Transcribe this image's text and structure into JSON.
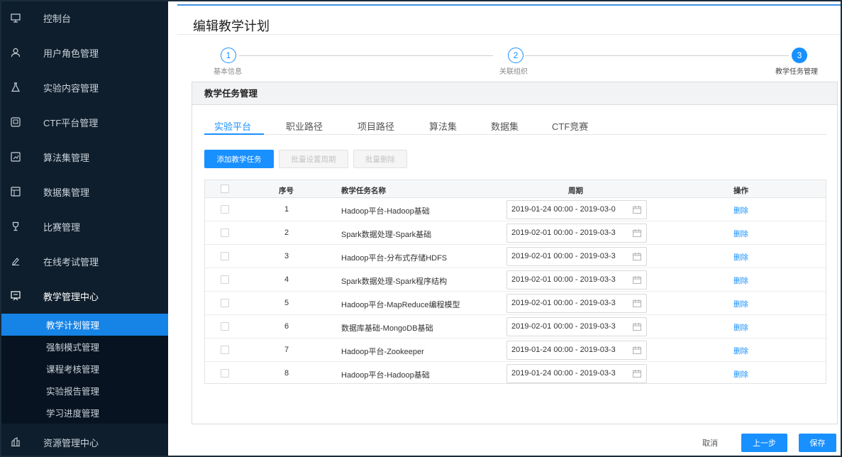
{
  "sidebar": {
    "items": [
      {
        "label": "控制台",
        "icon": "monitor-icon"
      },
      {
        "label": "用户角色管理",
        "icon": "user-icon"
      },
      {
        "label": "实验内容管理",
        "icon": "flask-icon"
      },
      {
        "label": "CTF平台管理",
        "icon": "screen-icon"
      },
      {
        "label": "算法集管理",
        "icon": "chart-icon"
      },
      {
        "label": "数据集管理",
        "icon": "dataset-icon"
      },
      {
        "label": "比赛管理",
        "icon": "trophy-icon"
      },
      {
        "label": "在线考试管理",
        "icon": "exam-icon"
      },
      {
        "label": "教学管理中心",
        "icon": "teaching-icon"
      },
      {
        "label": "资源管理中心",
        "icon": "resource-icon"
      }
    ],
    "sub_items": [
      {
        "label": "教学计划管理",
        "active": true
      },
      {
        "label": "强制模式管理",
        "active": false
      },
      {
        "label": "课程考核管理",
        "active": false
      },
      {
        "label": "实验报告管理",
        "active": false
      },
      {
        "label": "学习进度管理",
        "active": false
      }
    ]
  },
  "page": {
    "title": "编辑教学计划"
  },
  "steps": [
    {
      "num": "1",
      "label": "基本信息"
    },
    {
      "num": "2",
      "label": "关联组织"
    },
    {
      "num": "3",
      "label": "教学任务管理"
    }
  ],
  "panel": {
    "title": "教学任务管理"
  },
  "tabs": [
    "实验平台",
    "职业路径",
    "项目路径",
    "算法集",
    "数据集",
    "CTF竞赛"
  ],
  "buttons": {
    "add": "添加教学任务",
    "batch_period": "批量设置周期",
    "batch_delete": "批量删除"
  },
  "table": {
    "headers": {
      "index": "序号",
      "name": "教学任务名称",
      "period": "周期",
      "action": "操作"
    },
    "rows": [
      {
        "index": "1",
        "name": "Hadoop平台-Hadoop基础",
        "period": "2019-01-24 00:00 - 2019-03-0",
        "action": "删除"
      },
      {
        "index": "2",
        "name": "Spark数据处理-Spark基础",
        "period": "2019-02-01 00:00 - 2019-03-3",
        "action": "删除"
      },
      {
        "index": "3",
        "name": "Hadoop平台-分布式存储HDFS",
        "period": "2019-02-01 00:00 - 2019-03-3",
        "action": "删除"
      },
      {
        "index": "4",
        "name": "Spark数据处理-Spark程序结构",
        "period": "2019-02-01 00:00 - 2019-03-3",
        "action": "删除"
      },
      {
        "index": "5",
        "name": "Hadoop平台-MapReduce编程模型",
        "period": "2019-02-01 00:00 - 2019-03-3",
        "action": "删除"
      },
      {
        "index": "6",
        "name": "数据库基础-MongoDB基础",
        "period": "2019-02-01 00:00 - 2019-03-3",
        "action": "删除"
      },
      {
        "index": "7",
        "name": "Hadoop平台-Zookeeper",
        "period": "2019-01-24 00:00 - 2019-03-3",
        "action": "删除"
      },
      {
        "index": "8",
        "name": "Hadoop平台-Hadoop基础",
        "period": "2019-01-24 00:00 - 2019-03-3",
        "action": "删除"
      }
    ]
  },
  "footer": {
    "cancel": "取消",
    "prev": "上一步",
    "save": "保存"
  },
  "colors": {
    "accent": "#1890ff",
    "sidebar_bg": "#0f1e2c",
    "sidebar_sub_bg": "#071320"
  }
}
